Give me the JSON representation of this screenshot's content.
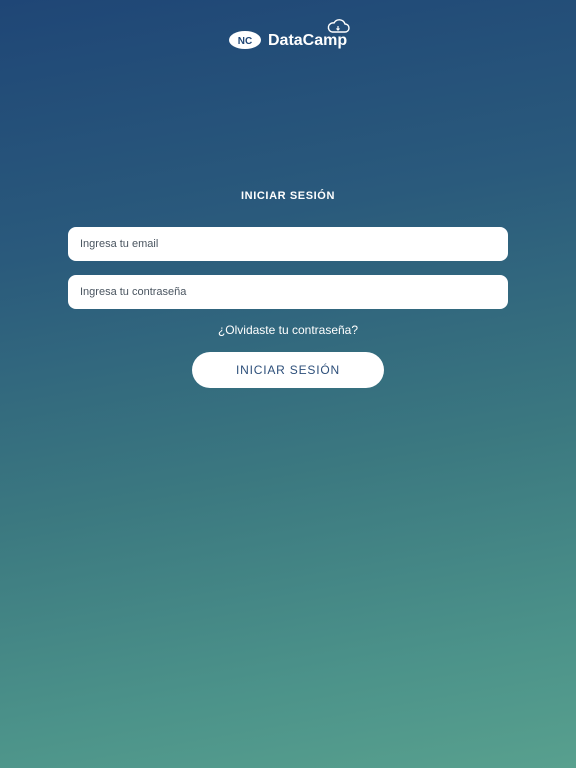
{
  "brand": {
    "badge_text": "NC",
    "name": "DataCamp"
  },
  "login": {
    "title": "INICIAR SESIÓN",
    "email_placeholder": "Ingresa tu email",
    "password_placeholder": "Ingresa tu contraseña",
    "forgot_label": "¿Olvidaste tu contraseña?",
    "submit_label": "INICIAR SESIÓN"
  },
  "colors": {
    "gradient_top": "#1f4676",
    "gradient_bottom": "#58a08e",
    "button_text": "#2d4f7a"
  }
}
